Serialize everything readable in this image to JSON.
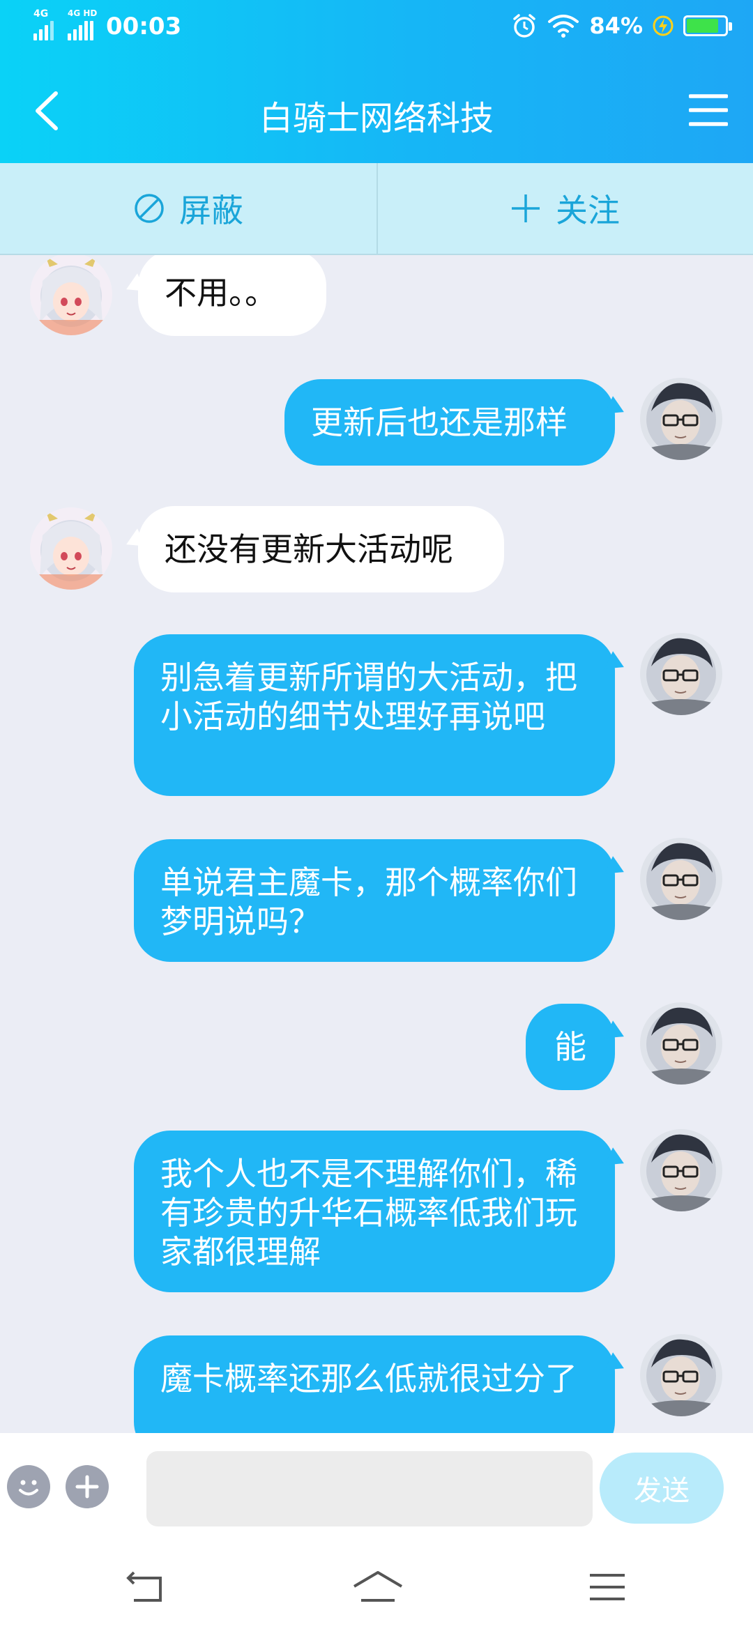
{
  "status_bar": {
    "net1": "4G",
    "net2": "4G HD",
    "time": "00:03",
    "battery_pct": "84%",
    "battery_level": 0.84
  },
  "header": {
    "title": "白骑士网络科技"
  },
  "actions": {
    "block_label": "屏蔽",
    "follow_label": "关注"
  },
  "messages": [
    {
      "side": "in",
      "text": "不用。。"
    },
    {
      "side": "out",
      "text": "更新后也还是那样"
    },
    {
      "side": "in",
      "text": "还没有更新大活动呢"
    },
    {
      "side": "out",
      "text": "别急着更新所谓的大活动，把小活动的细节处理好再说吧"
    },
    {
      "side": "out",
      "text": "单说君主魔卡，那个概率你们梦明说吗？"
    },
    {
      "side": "out",
      "text": "能"
    },
    {
      "side": "out",
      "text": "我个人也不是不理解你们，稀有珍贵的升华石概率低我们玩家都很理解"
    },
    {
      "side": "out",
      "text": "魔卡概率还那么低就很过分了"
    }
  ],
  "input_bar": {
    "placeholder": "",
    "send_label": "发送"
  },
  "colors": {
    "accent": "#21b7f6",
    "header_start": "#0ad2f7",
    "header_end": "#1ea7f5",
    "action_bar": "#c9eff9"
  }
}
